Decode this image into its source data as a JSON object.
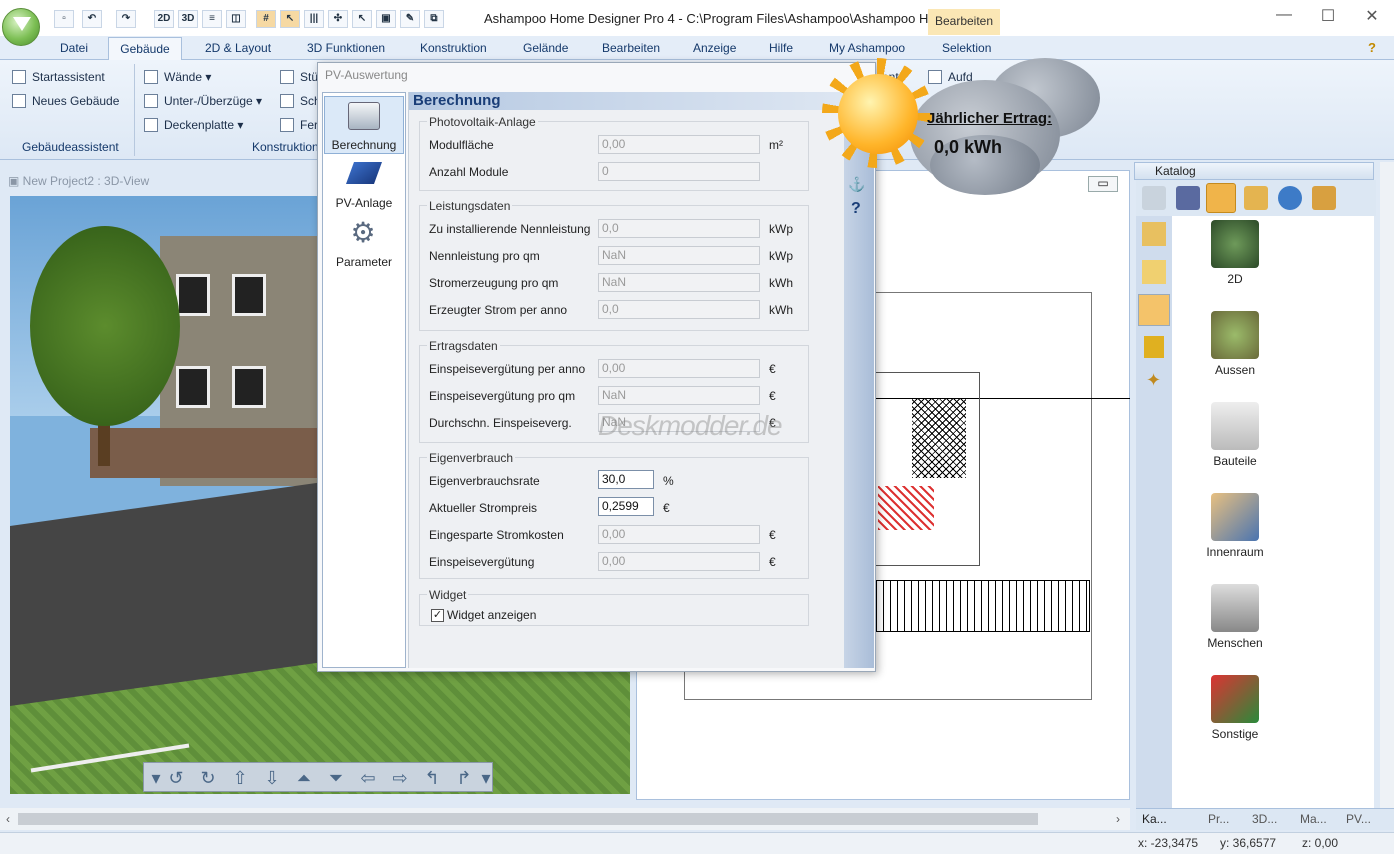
{
  "window": {
    "title": "Ashampoo Home Designer Pro 4 - C:\\Program Files\\Ashampoo\\Ashampoo Hom...",
    "context_tab": "Bearbeiten"
  },
  "quickbar": [
    "2D",
    "3D"
  ],
  "menu_tabs": [
    "Datei",
    "Gebäude",
    "2D & Layout",
    "3D Funktionen",
    "Konstruktion",
    "Gelände",
    "Bearbeiten",
    "Anzeige",
    "Hilfe",
    "My Ashampoo",
    "Selektion"
  ],
  "ribbon": {
    "assistant_items": [
      "Startassistent",
      "Neues Gebäude"
    ],
    "assistant_group": "Gebäudeassistent",
    "construction_items": [
      "Wände",
      "Unter-/Überzüge",
      "Deckenplatte"
    ],
    "construction_partial": [
      "Stü",
      "Sch",
      "Fer"
    ],
    "construction_group": "Konstruktion",
    "right_partial": [
      "ment",
      "Aufd"
    ]
  },
  "view3d": {
    "title": "New Project2 : 3D-View"
  },
  "dialog": {
    "title": "PV-Auswertung",
    "nav": [
      "Berechnung",
      "PV-Anlage",
      "Parameter"
    ],
    "header": "Berechnung",
    "sections": {
      "anlage": {
        "legend": "Photovoltaik-Anlage",
        "rows": [
          {
            "label": "Modulfläche",
            "value": "0,00",
            "unit": "m²"
          },
          {
            "label": "Anzahl Module",
            "value": "0",
            "unit": ""
          }
        ]
      },
      "leistung": {
        "legend": "Leistungsdaten",
        "rows": [
          {
            "label": "Zu installierende Nennleistung",
            "value": "0,0",
            "unit": "kWp"
          },
          {
            "label": "Nennleistung pro qm",
            "value": "NaN",
            "unit": "kWp"
          },
          {
            "label": "Stromerzeugung pro qm",
            "value": "NaN",
            "unit": "kWh"
          },
          {
            "label": "Erzeugter Strom per anno",
            "value": "0,0",
            "unit": "kWh"
          }
        ]
      },
      "ertrag": {
        "legend": "Ertragsdaten",
        "rows": [
          {
            "label": "Einspeisevergütung per anno",
            "value": "0,00",
            "unit": "€"
          },
          {
            "label": "Einspeisevergütung pro qm",
            "value": "NaN",
            "unit": "€"
          },
          {
            "label": "Durchschn. Einspeiseverg.",
            "value": "NaN",
            "unit": "€"
          }
        ]
      },
      "eigen": {
        "legend": "Eigenverbrauch",
        "rows": [
          {
            "label": "Eigenverbrauchsrate",
            "value": "30,0",
            "unit": "%"
          },
          {
            "label": "Aktueller Strompreis",
            "value": "0,2599",
            "unit": "€"
          },
          {
            "label": "Eingesparte Stromkosten",
            "value": "0,00",
            "unit": "€"
          },
          {
            "label": "Einspeisevergütung",
            "value": "0,00",
            "unit": "€"
          }
        ]
      },
      "widget": {
        "legend": "Widget",
        "checkbox_label": "Widget anzeigen",
        "checked": true
      }
    },
    "side_icons": [
      "?"
    ]
  },
  "watermark": "Deskmodder.de",
  "widget": {
    "label": "Jährlicher Ertrag:",
    "value": "0,0 kWh"
  },
  "catalog": {
    "title": "Katalog",
    "items": [
      "2D",
      "Aussen",
      "Bauteile",
      "Innenraum",
      "Menschen",
      "Sonstige"
    ],
    "bottom_tabs": [
      "Ka...",
      "Pr...",
      "3D...",
      "Ma...",
      "PV..."
    ]
  },
  "status": {
    "x": "x: -23,3475",
    "y": "y: 36,6577",
    "z": "z: 0,00"
  }
}
